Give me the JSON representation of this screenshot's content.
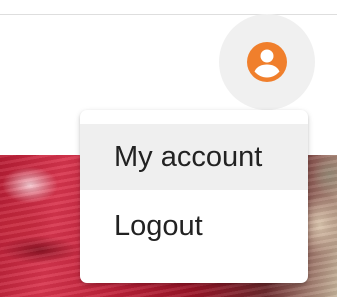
{
  "header": {
    "avatar_icon": "account-circle-icon",
    "accent_color": "#f07f2c"
  },
  "menu": {
    "items": [
      {
        "label": "My account",
        "highlighted": true
      },
      {
        "label": "Logout",
        "highlighted": false
      }
    ]
  }
}
